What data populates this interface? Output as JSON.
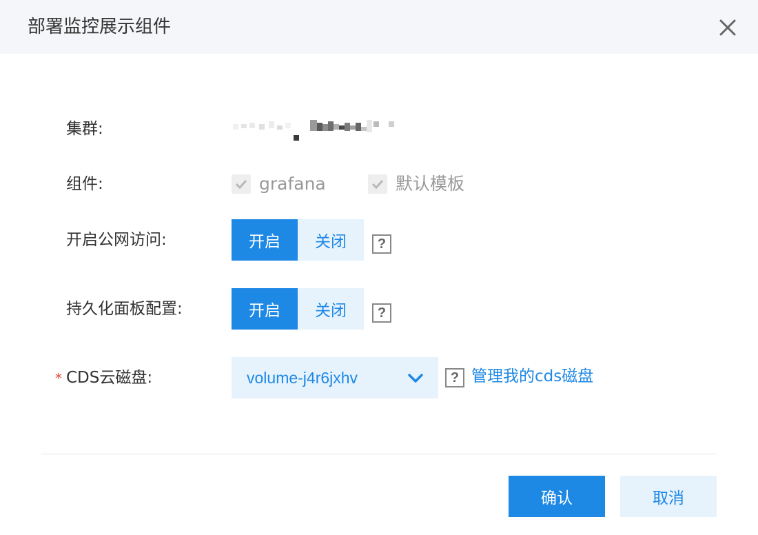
{
  "dialog": {
    "title": "部署监控展示组件"
  },
  "cluster": {
    "label": "集群:"
  },
  "components": {
    "label": "组件:",
    "items": [
      {
        "label": "grafana",
        "checked": true,
        "disabled": true
      },
      {
        "label": "默认模板",
        "checked": true,
        "disabled": true
      }
    ]
  },
  "public_access": {
    "label": "开启公网访问:",
    "on_label": "开启",
    "off_label": "关闭",
    "selected": "开启"
  },
  "persistent_dashboard": {
    "label": "持久化面板配置:",
    "on_label": "开启",
    "off_label": "关闭",
    "selected": "开启"
  },
  "cds_disk": {
    "required_mark": "*",
    "label": "CDS云磁盘:",
    "selected_value": "volume-j4r6jxhv",
    "manage_link": "管理我的cds磁盘"
  },
  "help_icon": "?",
  "footer": {
    "confirm_label": "确认",
    "cancel_label": "取消"
  },
  "colors": {
    "primary": "#1e88e5",
    "primary_light": "#e6f3fd",
    "header_bg": "#f5f6f9",
    "required": "#e8483c"
  }
}
